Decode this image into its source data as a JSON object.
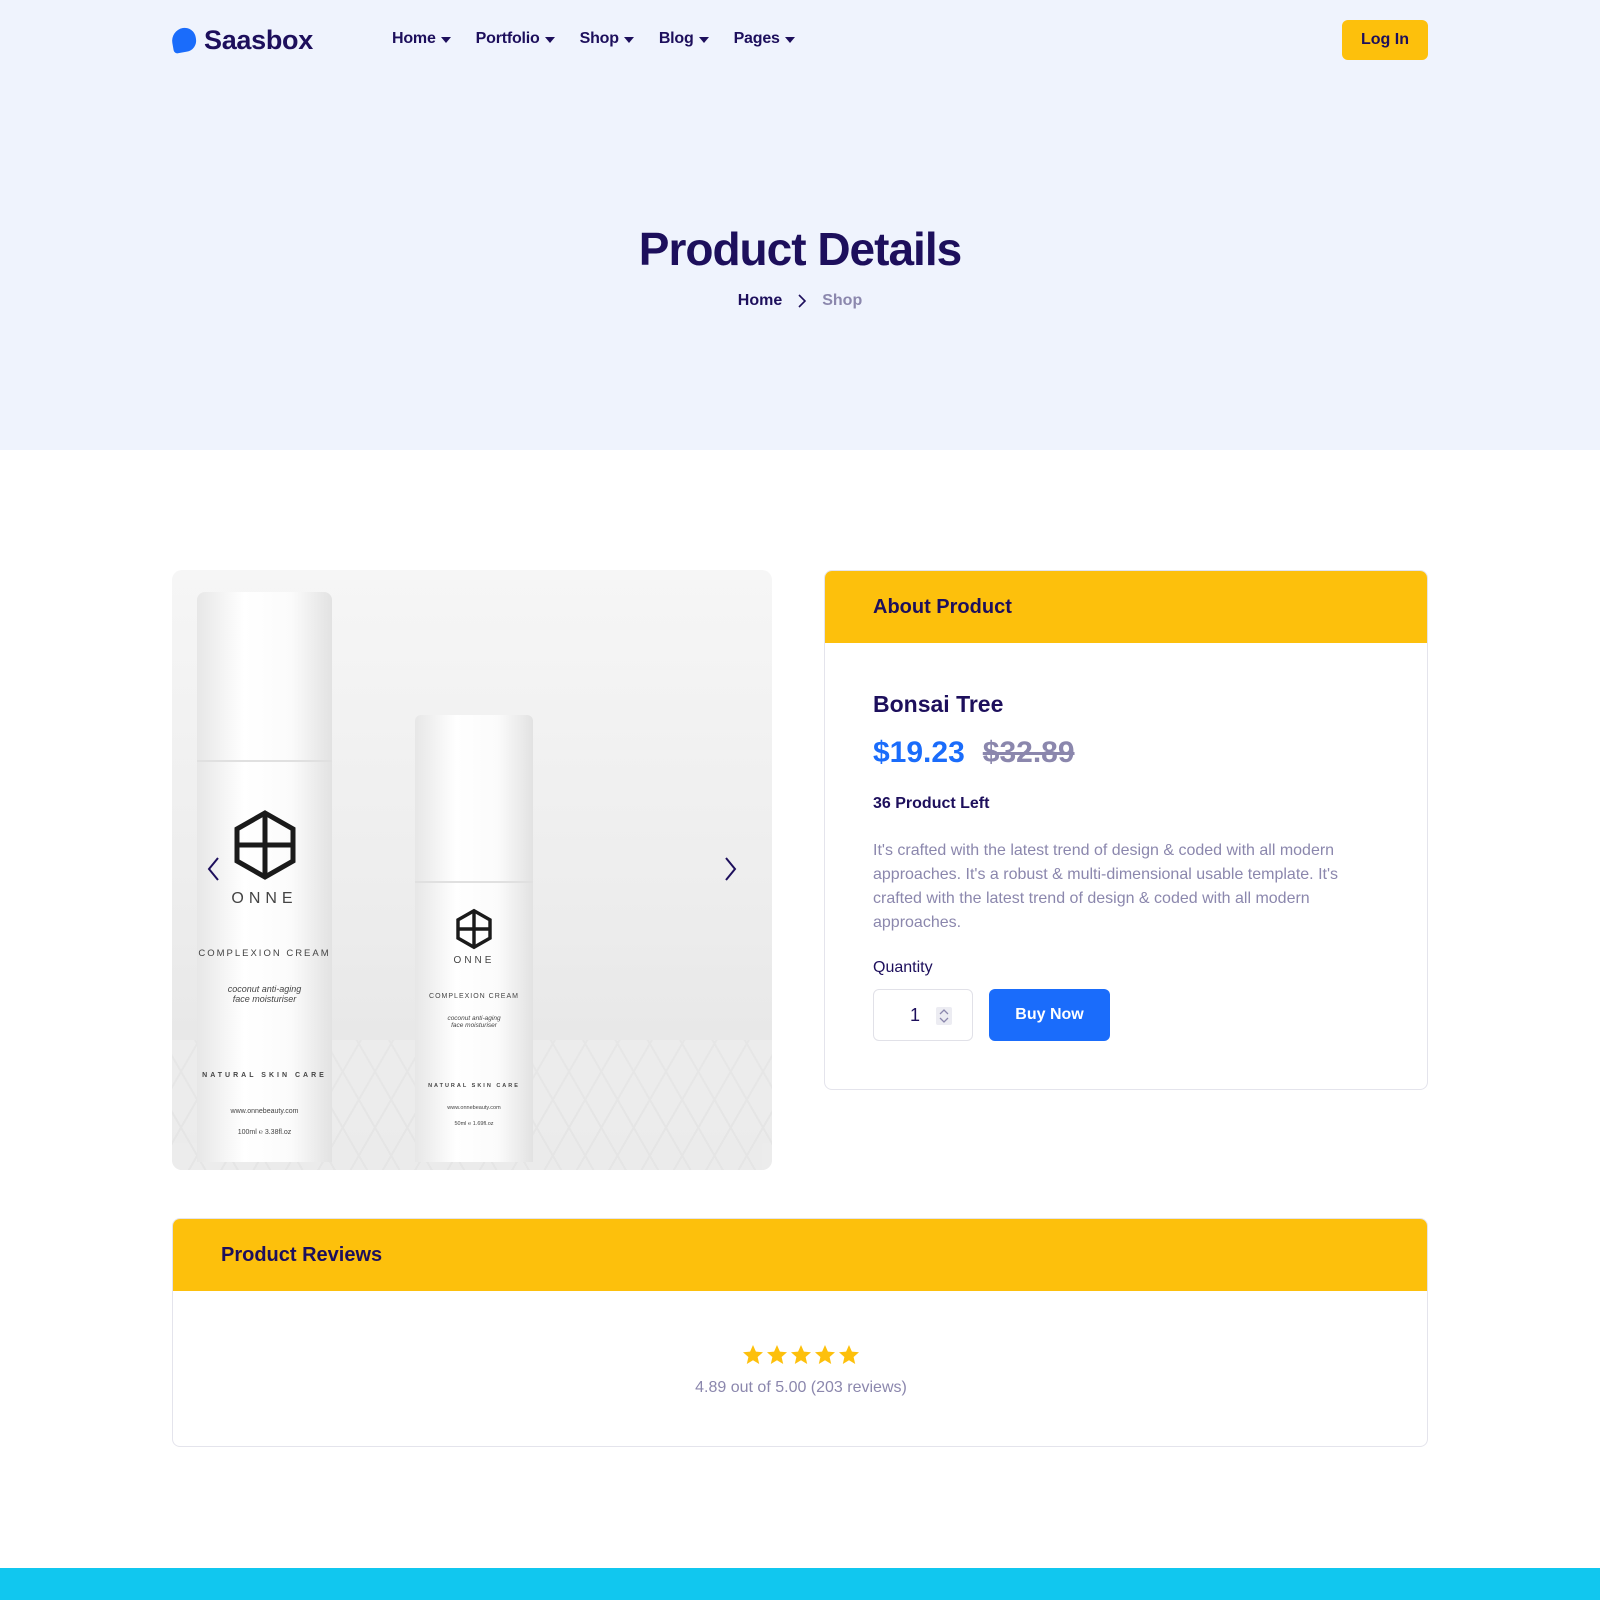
{
  "brand": {
    "name": "Saasbox",
    "accent": "#1a6cfb"
  },
  "nav": {
    "items": [
      {
        "label": "Home"
      },
      {
        "label": "Portfolio"
      },
      {
        "label": "Shop"
      },
      {
        "label": "Blog"
      },
      {
        "label": "Pages"
      }
    ],
    "login_label": "Log In"
  },
  "hero": {
    "title": "Product Details",
    "breadcrumb": {
      "home": "Home",
      "current": "Shop"
    }
  },
  "gallery": {
    "bottle_big": {
      "brand": "ONNE",
      "line": "COMPLEXION CREAM",
      "desc": "coconut anti-aging face moisturiser",
      "tag": "NATURAL SKIN CARE",
      "url": "www.onnebeauty.com",
      "size": "100ml ℮ 3.38fl.oz"
    },
    "bottle_small": {
      "brand": "ONNE",
      "line": "COMPLEXION CREAM",
      "desc": "coconut anti-aging face moisturiser",
      "tag": "NATURAL SKIN CARE",
      "url": "www.onnebeauty.com",
      "size": "50ml ℮ 1.69fl.oz"
    }
  },
  "about": {
    "heading": "About Product",
    "product_name": "Bonsai Tree",
    "price_current": "$19.23",
    "price_original": "$32.89",
    "stock": "36 Product Left",
    "description": "It's crafted with the latest trend of design & coded with all modern approaches. It's a robust & multi-dimensional usable template. It's crafted with the latest trend of design & coded with all modern approaches.",
    "quantity_label": "Quantity",
    "quantity_value": "1",
    "buy_label": "Buy Now"
  },
  "reviews": {
    "heading": "Product Reviews",
    "stars": 5,
    "summary": "4.89 out of 5.00 (203 reviews)"
  },
  "colors": {
    "primary": "#1a6cfb",
    "highlight": "#fdc00c",
    "text_dark": "#1d0f5c",
    "text_muted": "#8b87ad",
    "hero_bg": "#eff3fd",
    "footer": "#11c7ef"
  }
}
